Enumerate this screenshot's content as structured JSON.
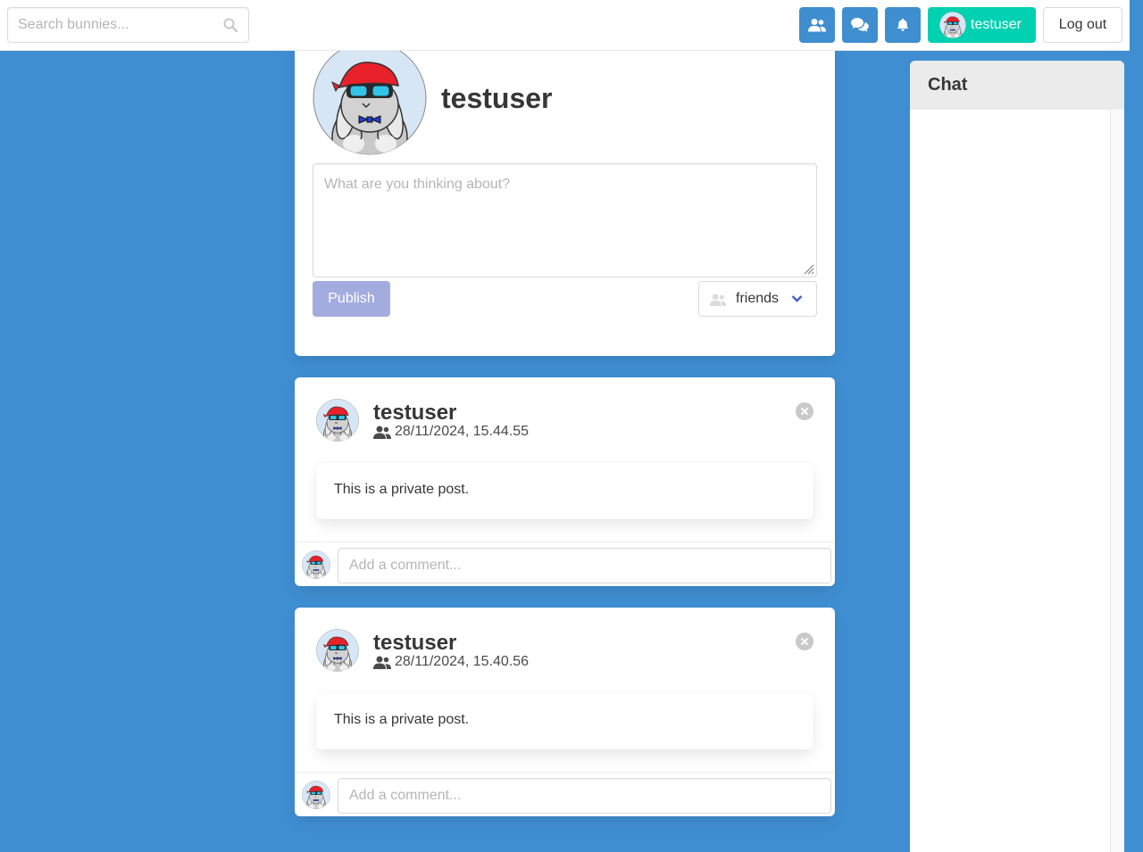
{
  "navbar": {
    "search_placeholder": "Search bunnies...",
    "friends_icon": "users-icon",
    "chat_icon": "comments-icon",
    "notifications_icon": "bell-icon",
    "username": "testuser",
    "logout_label": "Log out",
    "accent_color": "#3e8ed0",
    "user_button_color": "#00d1b2"
  },
  "profile": {
    "username": "testuser",
    "composer_placeholder": "What are you thinking about?",
    "publish_label": "Publish",
    "visibility_selected": "friends"
  },
  "posts": [
    {
      "author": "testuser",
      "timestamp": "28/11/2024, 15.44.55",
      "visibility_icon": "users-icon",
      "body": "This is a private post.",
      "comment_placeholder": "Add a comment..."
    },
    {
      "author": "testuser",
      "timestamp": "28/11/2024, 15.40.56",
      "visibility_icon": "users-icon",
      "body": "This is a private post.",
      "comment_placeholder": "Add a comment..."
    }
  ],
  "chat": {
    "title": "Chat"
  },
  "colors": {
    "background": "#3f8ed2",
    "publish_disabled": "#a3acdf"
  }
}
